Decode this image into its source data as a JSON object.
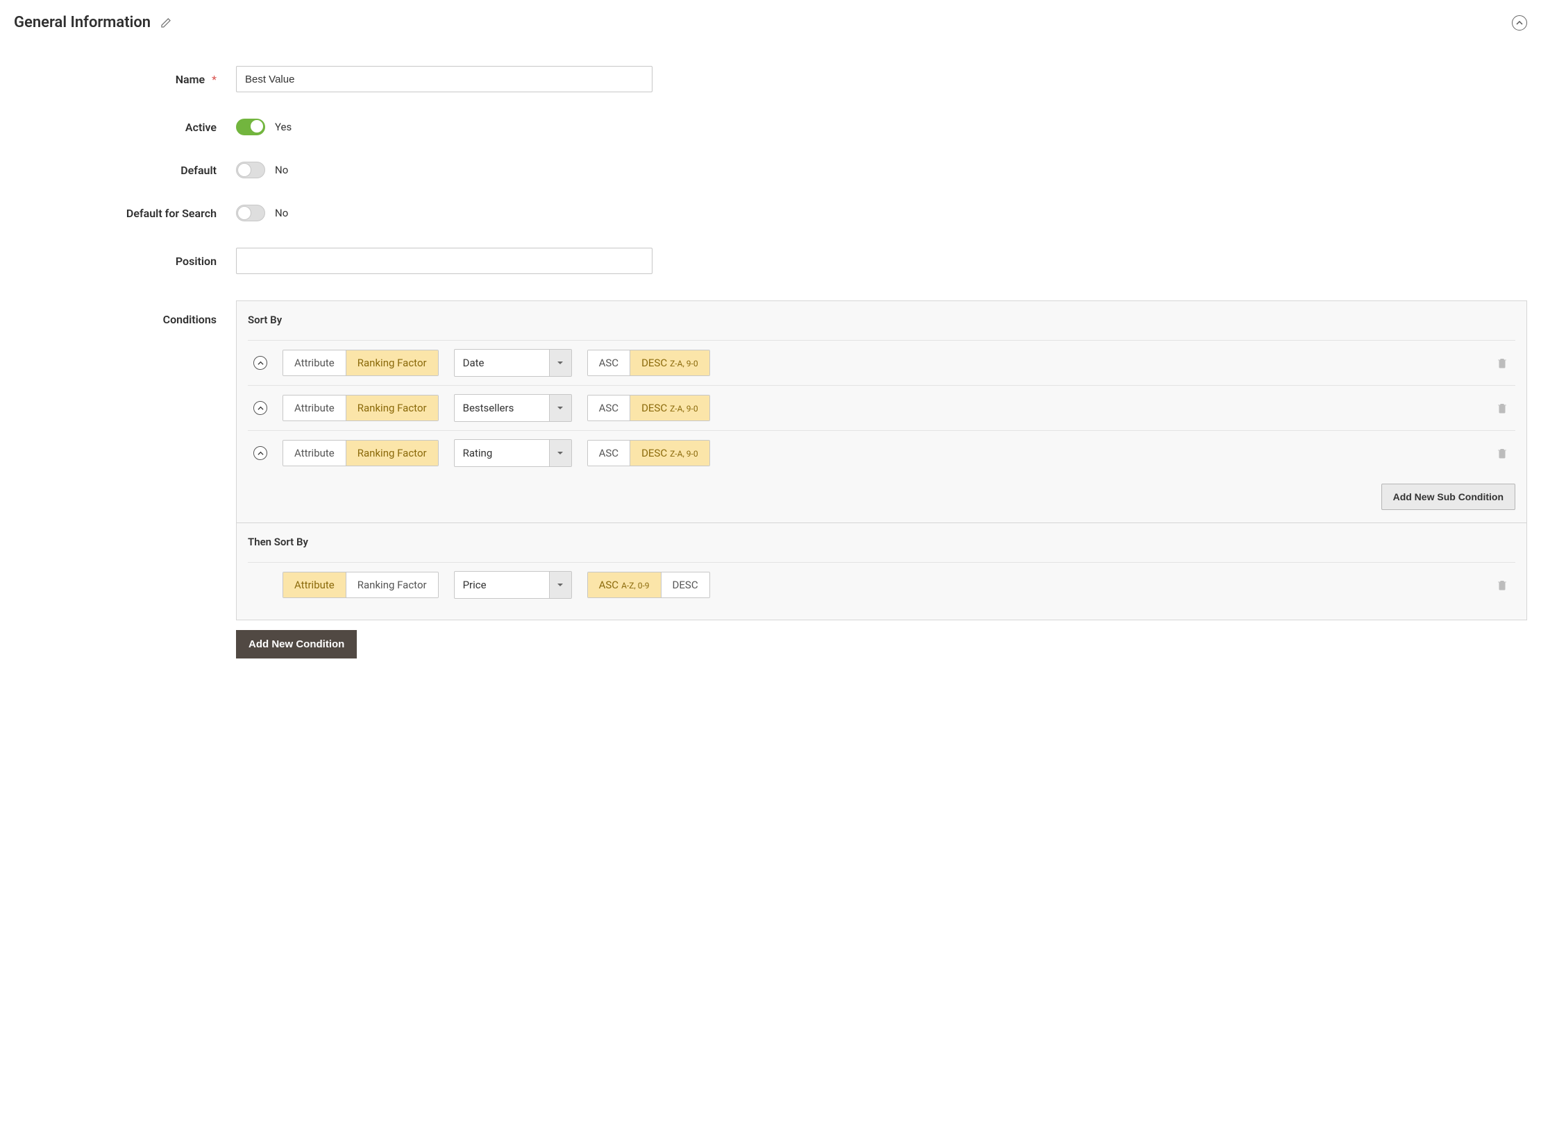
{
  "section": {
    "title": "General Information"
  },
  "fields": {
    "name": {
      "label": "Name",
      "required": "*",
      "value": "Best Value"
    },
    "active": {
      "label": "Active",
      "value": "Yes"
    },
    "default": {
      "label": "Default",
      "value": "No"
    },
    "defaultForSearch": {
      "label": "Default for Search",
      "value": "No"
    },
    "position": {
      "label": "Position",
      "value": ""
    },
    "conditions": {
      "label": "Conditions"
    }
  },
  "segments": {
    "attribute": "Attribute",
    "rankingFactor": "Ranking Factor",
    "asc": "ASC",
    "desc": "DESC",
    "asc_sub": "A-Z, 0-9",
    "desc_sub": "Z-A, 9-0"
  },
  "conditions": {
    "sortBy": {
      "title": "Sort By",
      "rows": [
        {
          "value": "Date"
        },
        {
          "value": "Bestsellers"
        },
        {
          "value": "Rating"
        }
      ],
      "addSub": "Add New Sub Condition"
    },
    "thenSortBy": {
      "title": "Then Sort By",
      "row": {
        "value": "Price"
      }
    },
    "addCondition": "Add New Condition"
  }
}
